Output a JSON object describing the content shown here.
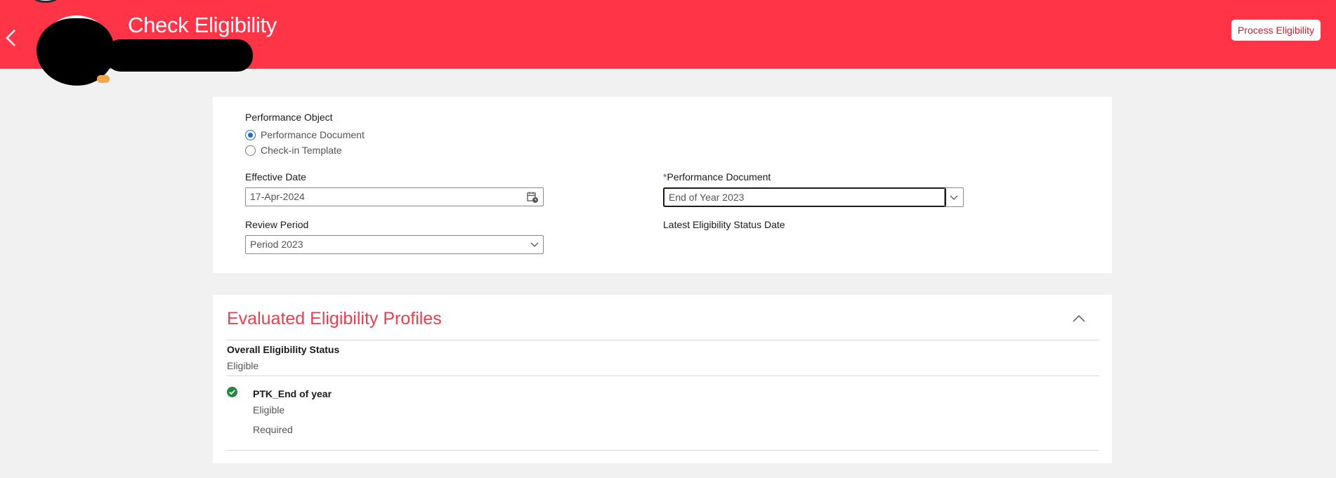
{
  "header": {
    "title": "Check Eligibility",
    "process_button": "Process Eligibility",
    "avatar_badge": "...",
    "colors": {
      "background": "#ff3447",
      "text": "#ffffff",
      "button_text": "#d7182a"
    }
  },
  "criteria": {
    "performance_object": {
      "label": "Performance Object",
      "options": [
        {
          "label": "Performance Document",
          "selected": true
        },
        {
          "label": "Check-in Template",
          "selected": false
        }
      ]
    },
    "effective_date": {
      "label": "Effective Date",
      "value": "17-Apr-2024",
      "icon": "calendar-icon"
    },
    "review_period": {
      "label": "Review Period",
      "value": "Period 2023",
      "icon": "chevron-down-icon"
    },
    "performance_document": {
      "required_marker": "*",
      "label": "Performance Document",
      "value": "End of Year 2023",
      "icon": "chevron-down-icon"
    },
    "latest_status_date": {
      "label": "Latest Eligibility Status Date"
    }
  },
  "profiles": {
    "title": "Evaluated Eligibility Profiles",
    "overall_label": "Overall Eligibility Status",
    "overall_value": "Eligible",
    "items": [
      {
        "name": "PTK_End of year",
        "status": "Eligible",
        "requirement": "Required",
        "icon": "check-circle-icon",
        "icon_color": "#1f8a3a"
      }
    ]
  }
}
